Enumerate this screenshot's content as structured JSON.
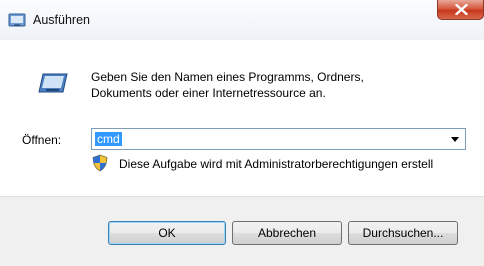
{
  "window": {
    "title": "Ausführen",
    "icon": "run-dialog-icon"
  },
  "dialog": {
    "description_line1": "Geben Sie den Namen eines Programms, Ordners,",
    "description_line2": "Dokuments oder einer Internetressource an.",
    "open_label": "Öffnen:",
    "open_value": "cmd",
    "admin_note": "Diese Aufgabe wird mit Administratorberechtigungen erstell",
    "shield_icon": "uac-shield-icon"
  },
  "buttons": {
    "ok": "OK",
    "cancel": "Abbrechen",
    "browse": "Durchsuchen..."
  },
  "colors": {
    "selection": "#3399ff",
    "close_button": "#c7381c",
    "footer_background": "#f0f0f0",
    "default_button_border": "#3c7fb1"
  }
}
